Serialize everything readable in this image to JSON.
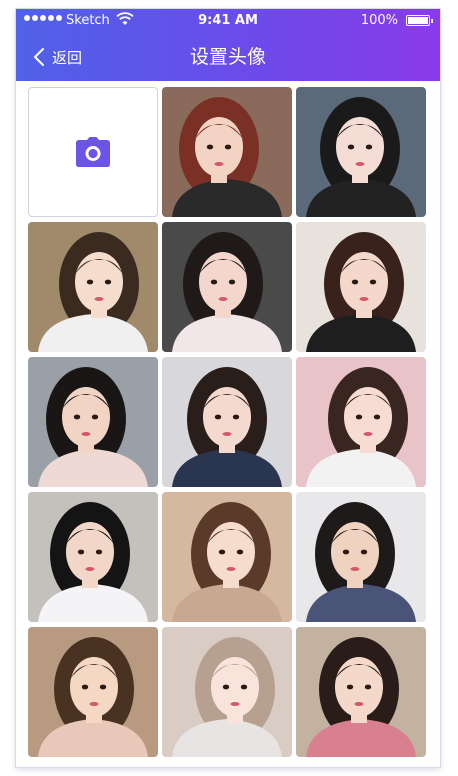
{
  "status_bar": {
    "carrier": "Sketch",
    "time": "9:41 AM",
    "battery": "100%"
  },
  "nav": {
    "back_label": "返回",
    "title": "设置头像"
  },
  "colors": {
    "header_gradient_start": "#4f62e8",
    "header_gradient_end": "#8a3ae8",
    "camera_icon": "#6b55e8"
  },
  "grid": {
    "first_item_icon": "camera-icon",
    "photos": [
      {
        "bg": "#8a6a5a",
        "skin": "#f3d3c3",
        "hair": "#7a3025",
        "top": "#2a2a2a"
      },
      {
        "bg": "#5b6a7a",
        "skin": "#f5dcd5",
        "hair": "#1a1a1a",
        "top": "#222222"
      },
      {
        "bg": "#a08a6a",
        "skin": "#f6dccc",
        "hair": "#3a2a20",
        "top": "#f0f0f0"
      },
      {
        "bg": "#4a4a4a",
        "skin": "#f4d6cc",
        "hair": "#1f1a18",
        "top": "#f2e6e8"
      },
      {
        "bg": "#e8e2dc",
        "skin": "#f5d8cc",
        "hair": "#3a221c",
        "top": "#1e1e1e"
      },
      {
        "bg": "#9aa0a8",
        "skin": "#f1d4c4",
        "hair": "#1a1616",
        "top": "#efd9d4"
      },
      {
        "bg": "#d8d8dc",
        "skin": "#f4dace",
        "hair": "#2a1e1a",
        "top": "#2a3550"
      },
      {
        "bg": "#e8c4c8",
        "skin": "#f6dcd2",
        "hair": "#3a2620",
        "top": "#f2f2f2"
      },
      {
        "bg": "#c4c0bc",
        "skin": "#f2d6c8",
        "hair": "#141414",
        "top": "#f4f4f6"
      },
      {
        "bg": "#d4b8a0",
        "skin": "#f6dccc",
        "hair": "#5a3a28",
        "top": "#c8a890"
      },
      {
        "bg": "#e8e8ea",
        "skin": "#f0d2c0",
        "hair": "#1e1a1a",
        "top": "#4a5478"
      },
      {
        "bg": "#b89a80",
        "skin": "#f4d8c4",
        "hair": "#4a3222",
        "top": "#e8c8b8"
      },
      {
        "bg": "#d8ccc4",
        "skin": "#f8e4da",
        "hair": "#b8a090",
        "top": "#e8e4e4"
      },
      {
        "bg": "#c4b2a0",
        "skin": "#f4d8ca",
        "hair": "#2a1c18",
        "top": "#d88090"
      }
    ]
  }
}
